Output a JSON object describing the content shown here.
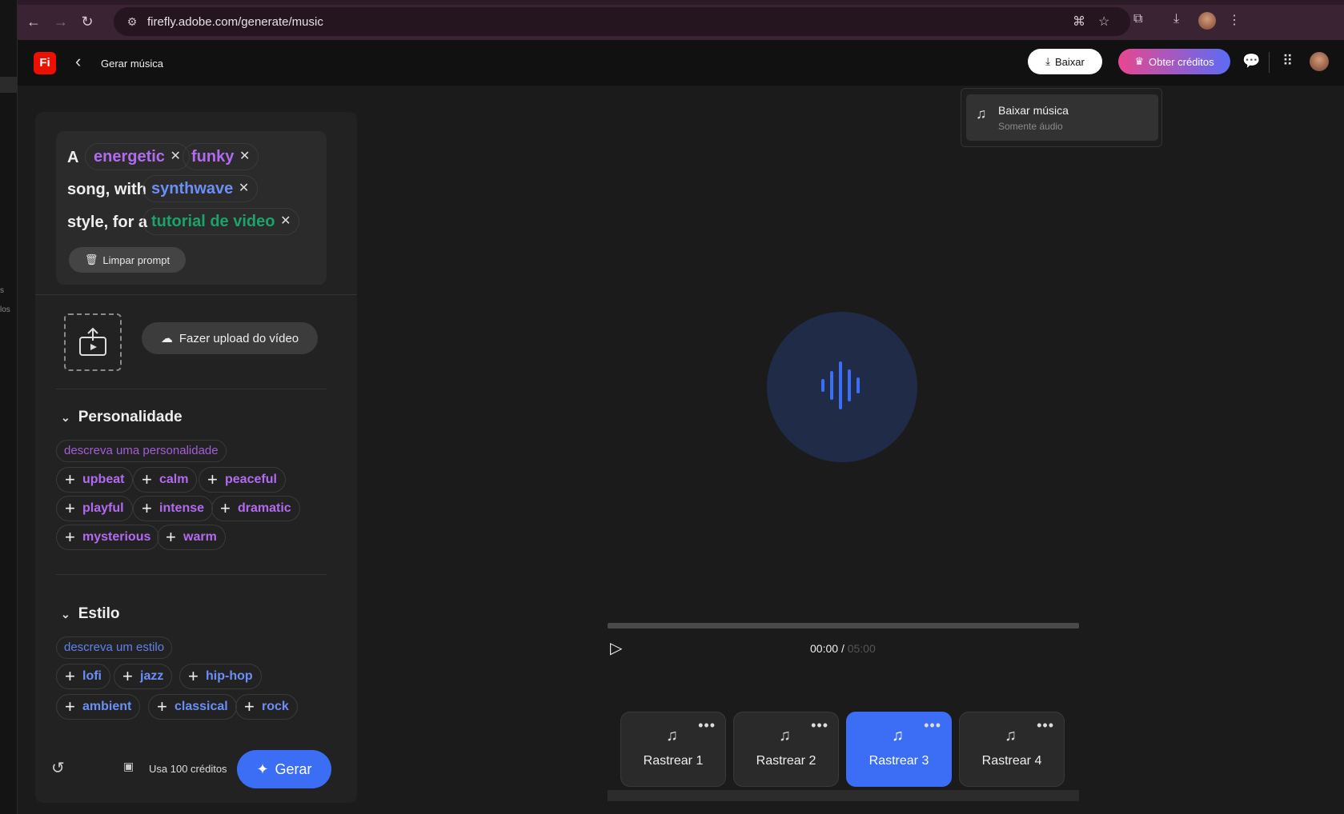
{
  "browser": {
    "url": "firefly.adobe.com/generate/music",
    "left_strip_texts": [
      "s",
      "los"
    ]
  },
  "header": {
    "logo": "Fi",
    "title": "Gerar música",
    "download_label": "Baixar",
    "credits_label": "Obter créditos"
  },
  "download_menu": {
    "title": "Baixar música",
    "subtitle": "Somente áudio"
  },
  "prompt": {
    "text1": "A",
    "chip1": "energetic",
    "chip2": "funky",
    "text2": "song, with",
    "chip3": "synthwave",
    "text3": "style, for a",
    "chip4": "tutorial de video",
    "clear_label": "Limpar prompt"
  },
  "upload": {
    "label": "Fazer upload do vídeo"
  },
  "personality": {
    "title": "Personalidade",
    "placeholder": "descreva uma personalidade",
    "tags": [
      "upbeat",
      "calm",
      "peaceful",
      "playful",
      "intense",
      "dramatic",
      "mysterious",
      "warm"
    ]
  },
  "style": {
    "title": "Estilo",
    "placeholder": "descreva um estilo",
    "tags": [
      "lofi",
      "jazz",
      "hip-hop",
      "ambient",
      "classical",
      "rock"
    ]
  },
  "footer": {
    "credits_text": "Usa 100 créditos",
    "generate_label": "Gerar"
  },
  "player": {
    "current_time": "00:00",
    "separator": "/",
    "total_time": "05:00"
  },
  "tracks": [
    "Rastrear 1",
    "Rastrear 2",
    "Rastrear 3",
    "Rastrear 4"
  ],
  "colors": {
    "accent_blue": "#3c6ef5",
    "chip_purple": "#b26bf0",
    "chip_blue": "#6b8ff5",
    "chip_green": "#1aa36a",
    "adobe_red": "#eb1000"
  }
}
